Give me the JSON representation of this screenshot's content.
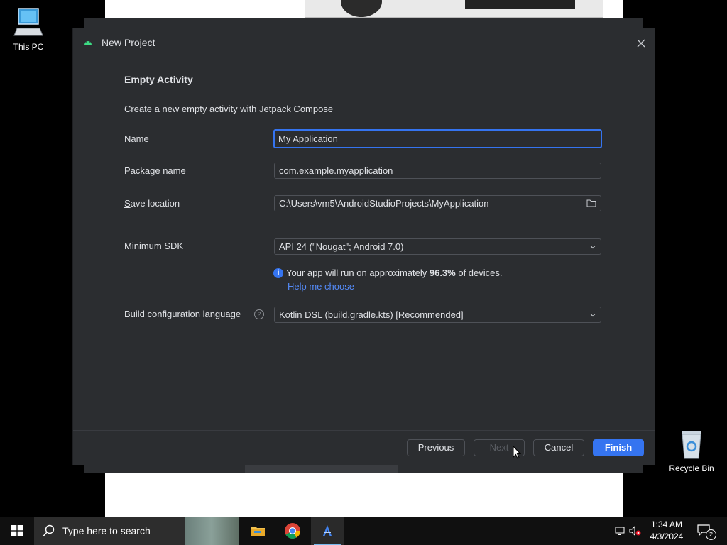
{
  "desktop": {
    "icons": [
      {
        "label": "This PC"
      },
      {
        "label": "Recycle Bin"
      }
    ]
  },
  "dialog": {
    "title": "New Project",
    "heading": "Empty Activity",
    "description": "Create a new empty activity with Jetpack Compose",
    "name": {
      "label_accel": "N",
      "label_rest": "ame",
      "value": "My Application"
    },
    "package": {
      "label_accel": "P",
      "label_rest": "ackage name",
      "value": "com.example.myapplication"
    },
    "save_location": {
      "label_accel": "S",
      "label_rest": "ave location",
      "value": "C:\\Users\\vm5\\AndroidStudioProjects\\MyApplication"
    },
    "min_sdk": {
      "label": "Minimum SDK",
      "value": "API 24 (\"Nougat\"; Android 7.0)"
    },
    "info": {
      "prefix": "Your app will run on approximately ",
      "percent": "96.3%",
      "suffix": " of devices.",
      "help_link": "Help me choose"
    },
    "build_lang": {
      "label": "Build configuration language",
      "value": "Kotlin DSL (build.gradle.kts) [Recommended]"
    },
    "buttons": {
      "previous": "Previous",
      "next": "Next",
      "cancel": "Cancel",
      "finish": "Finish"
    }
  },
  "taskbar": {
    "search_placeholder": "Type here to search",
    "time": "1:34 AM",
    "date": "4/3/2024",
    "notification_count": "2"
  },
  "colors": {
    "accent": "#3574f0",
    "dialog_bg": "#2b2d30",
    "link": "#548af7"
  }
}
